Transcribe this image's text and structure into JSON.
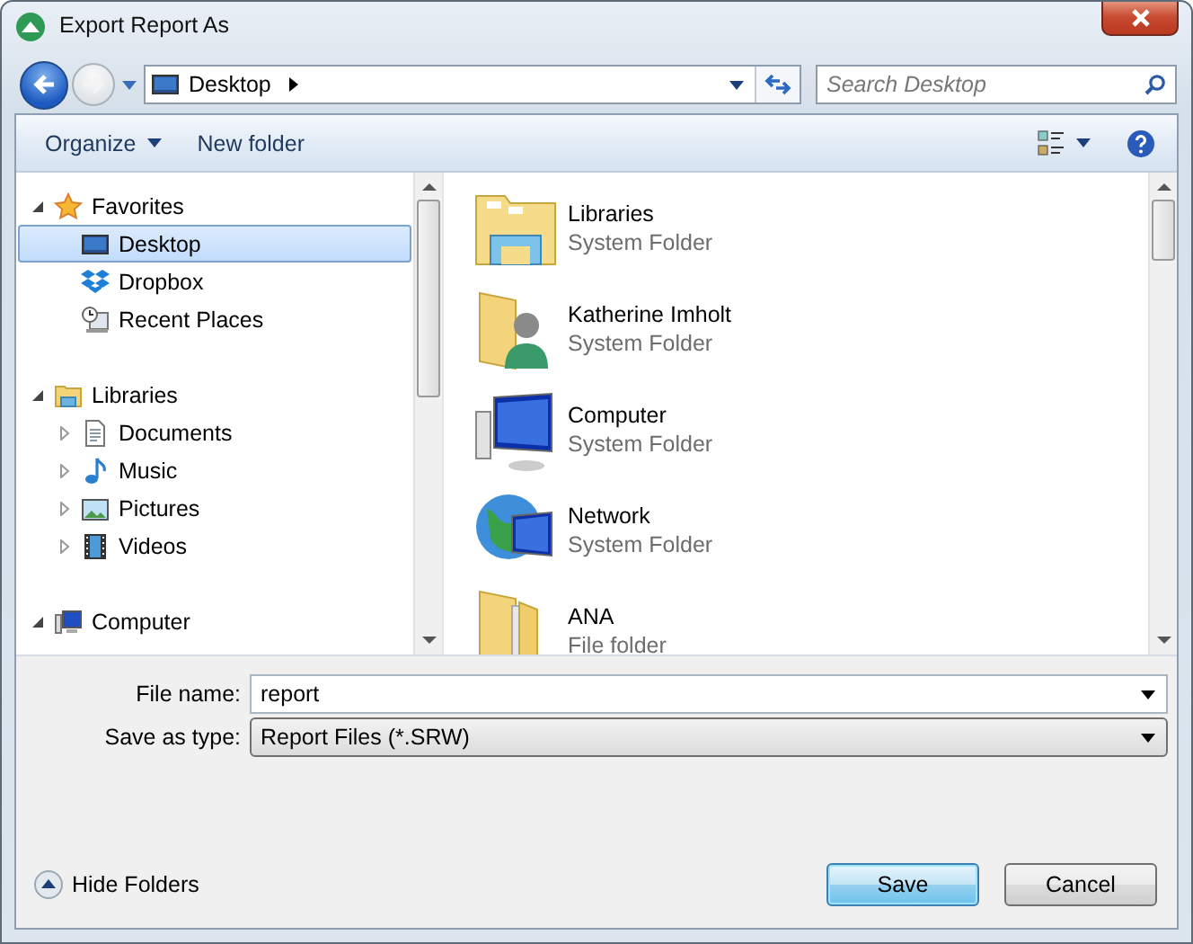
{
  "window": {
    "title": "Export Report As"
  },
  "navigation": {
    "address": "Desktop",
    "search": {
      "placeholder": "Search Desktop"
    }
  },
  "toolbar": {
    "organize": "Organize",
    "new_folder": "New folder"
  },
  "sidebar": {
    "groups": [
      {
        "label": "Favorites",
        "kind": "star",
        "expanded": true,
        "children": [
          {
            "label": "Desktop",
            "kind": "desktop",
            "selected": true
          },
          {
            "label": "Dropbox",
            "kind": "dropbox",
            "selected": false
          },
          {
            "label": "Recent Places",
            "kind": "recent",
            "selected": false
          }
        ]
      },
      {
        "label": "Libraries",
        "kind": "library",
        "expanded": true,
        "children": [
          {
            "label": "Documents",
            "kind": "documents",
            "selected": false,
            "expanded": false
          },
          {
            "label": "Music",
            "kind": "music",
            "selected": false,
            "expanded": false
          },
          {
            "label": "Pictures",
            "kind": "pictures",
            "selected": false,
            "expanded": false
          },
          {
            "label": "Videos",
            "kind": "videos",
            "selected": false,
            "expanded": false
          }
        ]
      },
      {
        "label": "Computer",
        "kind": "computer",
        "expanded": true
      }
    ]
  },
  "files": [
    {
      "name": "Libraries",
      "type": "System Folder",
      "kind": "library"
    },
    {
      "name": "Katherine Imholt",
      "type": "System Folder",
      "kind": "user"
    },
    {
      "name": "Computer",
      "type": "System Folder",
      "kind": "computer"
    },
    {
      "name": "Network",
      "type": "System Folder",
      "kind": "network"
    },
    {
      "name": "ANA",
      "type": "File folder",
      "kind": "folder"
    }
  ],
  "form": {
    "file_name": {
      "label": "File name:",
      "value": "report"
    },
    "save_as_type": {
      "label": "Save as type:",
      "value": "Report Files (*.SRW)"
    }
  },
  "footer": {
    "hide_folders": "Hide Folders",
    "save": "Save",
    "cancel": "Cancel"
  }
}
